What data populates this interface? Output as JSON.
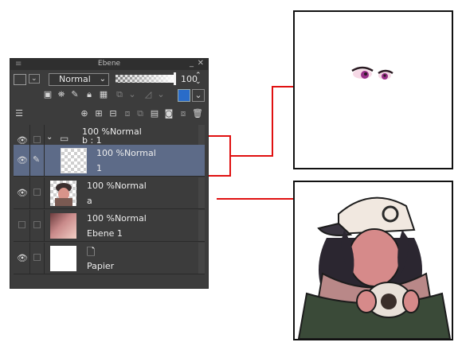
{
  "panel": {
    "title": "Ebene",
    "blend_mode": "Normal",
    "opacity_value": "100",
    "opacity_fraction": 1.0
  },
  "layers": [
    {
      "name": "b : 1",
      "opacity_mode": "100 %Normal",
      "type": "folder",
      "visible": true
    },
    {
      "name": "1",
      "opacity_mode": "100 %Normal",
      "type": "raster",
      "visible": true,
      "selected": true
    },
    {
      "name": "a",
      "opacity_mode": "100 %Normal",
      "type": "raster",
      "visible": true
    },
    {
      "name": "Ebene 1",
      "opacity_mode": "100 %Normal",
      "type": "raster",
      "visible": false
    },
    {
      "name": "Papier",
      "opacity_mode": "",
      "type": "paper",
      "visible": true
    }
  ],
  "colors": {
    "panel_bg": "#3c3c3c",
    "selected_row": "#5d6b88",
    "connector": "#e01010"
  },
  "icons": {
    "eye": "eye-icon",
    "pen": "pen-icon",
    "folder": "folder-icon",
    "page": "page-icon",
    "close": "close-icon",
    "minimize": "minimize-icon"
  }
}
